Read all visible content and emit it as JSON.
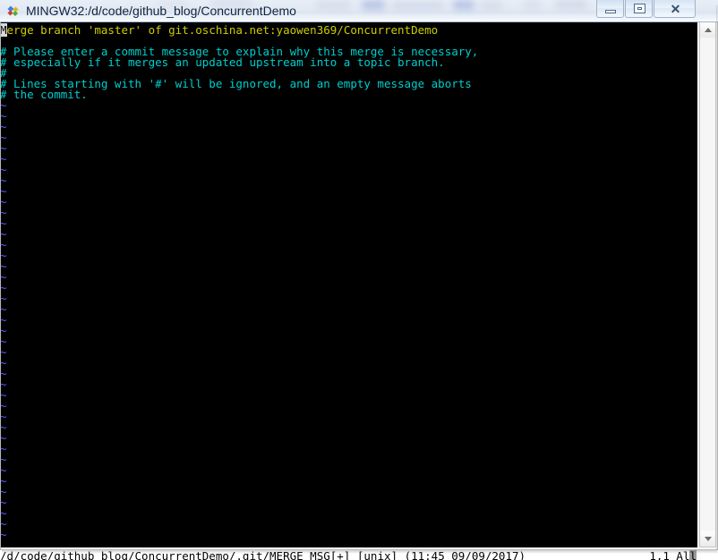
{
  "window": {
    "title": "MINGW32:/d/code/github_blog/ConcurrentDemo",
    "icon": "mingw-diamond-icon",
    "buttons": {
      "minimize": "minimize-button",
      "maximize": "maximize-button",
      "close": "✕"
    }
  },
  "terminal": {
    "background": "#000000",
    "colors": {
      "yellow": "#cdcd00",
      "cyan": "#00cdcd",
      "blue": "#5c5cff",
      "cursor": "#d8d8d8"
    },
    "lines": [
      {
        "type": "commit-subject",
        "color": "yellow",
        "cursor_head": "M",
        "text": "erge branch 'master' of git.oschina.net:yaowen369/ConcurrentDemo"
      },
      {
        "type": "blank",
        "color": "none",
        "text": ""
      },
      {
        "type": "comment",
        "color": "cyan",
        "text": "# Please enter a commit message to explain why this merge is necessary,"
      },
      {
        "type": "comment",
        "color": "cyan",
        "text": "# especially if it merges an updated upstream into a topic branch."
      },
      {
        "type": "comment",
        "color": "cyan",
        "text": "#"
      },
      {
        "type": "comment",
        "color": "cyan",
        "text": "# Lines starting with '#' will be ignored, and an empty message aborts"
      },
      {
        "type": "comment",
        "color": "cyan",
        "text": "# the commit."
      }
    ],
    "tilde_marker": "~",
    "tilde_count": 41
  },
  "statusline": {
    "file": "/d/code/github_blog/ConcurrentDemo/.git/MERGE_MSG[+]",
    "fileformat": "[unix]",
    "timestamp": "(11:45 09/09/2017)",
    "position": "1,1 Al",
    "position_tail": "l"
  },
  "scrollbar": {
    "up_arrow": "scroll-up-icon",
    "down_arrow": "scroll-down-icon"
  }
}
